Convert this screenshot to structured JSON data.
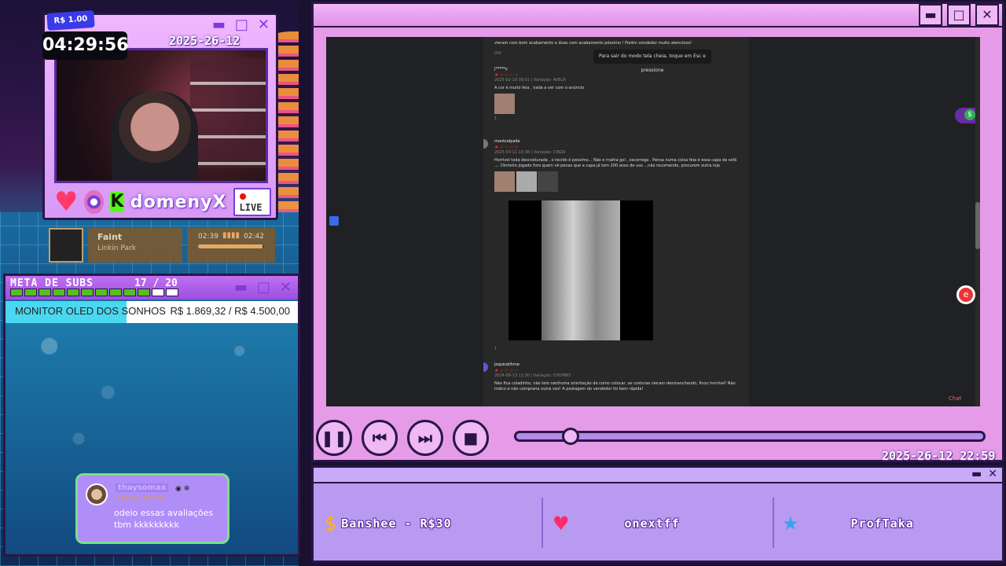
{
  "stream": {
    "timer": "04:29:56",
    "price_tag": "R$ 1.00",
    "datetime": "2025-26-12 22:59",
    "channel": "domenyX",
    "live_label": "LIVE"
  },
  "webcam_window": {
    "minimize_glyph": "▬",
    "maximize_glyph": "□",
    "close_glyph": "✕"
  },
  "music": {
    "title": "Faint",
    "artist": "Linkin Park",
    "elapsed": "02:39",
    "duration": "02:42",
    "progress_fraction": 0.98
  },
  "subs_goal": {
    "title": "META DE SUBS",
    "count": "17 / 20",
    "current": 17,
    "target": 20,
    "goal_name": "MONITOR OLED DOS SONHOS",
    "goal_value": "R$ 1.869,32 / R$ 4.500,00",
    "goal_fraction": 0.415
  },
  "chat": {
    "username": "thaysomax",
    "badge": "3 Meses Inscrito",
    "message": "odeio essas avaliações tbm kkkkkkkkk"
  },
  "browser": {
    "fullscreen_tip": "Para sair do modo tela cheia, toque em Esc e pressione",
    "chat_link": "Chat",
    "reviews": [
      {
        "user": "",
        "stars": "★☆☆☆☆",
        "meta": "",
        "text": "vieram com bom acabamento e duas com acabamento péssimo ! Porém vendedor muito atencioso!",
        "likes": "Útil"
      },
      {
        "user": "j*****y",
        "stars": "★☆☆☆☆",
        "meta": "2025-02-19 09:01 | Variação: AVELÃ",
        "text": "A cor é muito feia , nada a ver com o anúncio",
        "likes": "1"
      },
      {
        "user": "montcelpaila",
        "stars": "★☆☆☆☆",
        "meta": "2025-03-11 10:38 | Variação: CINZA",
        "text": "Horrível toda descosturada , o tecido é pessimo... Não e malha gol , escorrega . Pensa numa coisa feia é essa capa de sofá .... Dinheiro jogado fora quem vê penas que a capa já tem 200 anos de uso ...não recomendo, procurem outra loja",
        "likes": "1"
      },
      {
        "user": "joquicelihme",
        "stars": "★☆☆☆☆",
        "meta": "2024-08-13 12:30 | Variação: CHUMBO",
        "text": "Não fica coladinho, não tem nenhuma orientação de como colocar, as costuras vieram desmanchando, ficou horrível! Não indico e não compraria outra vez! A postagem do vendedor foi bem rápida!",
        "likes": ""
      }
    ]
  },
  "player": {
    "pause_glyph": "❚❚",
    "prev_glyph": "⏮",
    "next_glyph": "⏭",
    "stop_glyph": "■",
    "seek_fraction": 0.12
  },
  "events": {
    "latest_donation": "Banshee - R$30",
    "latest_follower": "onextff",
    "latest_sub": "ProfTaka"
  },
  "colors": {
    "window_pink": "#e59be8",
    "window_border": "#2a1646",
    "accent_purple": "#7a3ed8",
    "live_red": "#e11111",
    "goal_cyan": "#4ad8f0"
  }
}
